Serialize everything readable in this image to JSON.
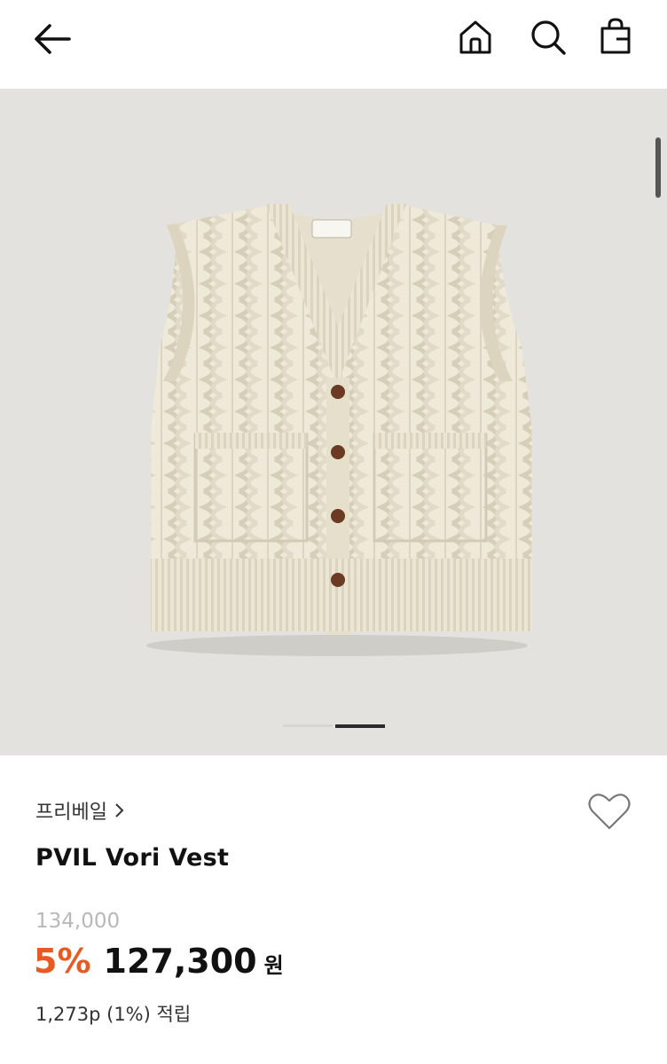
{
  "header": {
    "icons": [
      "arrow-left-icon",
      "home-icon",
      "search-icon",
      "shopping-bag-icon"
    ]
  },
  "gallery": {
    "image": "cream cable-knit vest with brown buttons",
    "slide_count": 2,
    "active_slide": 2
  },
  "product": {
    "brand": "프리베일",
    "title": "PVIL Vori Vest",
    "original_price": "134,000",
    "discount_rate": "5%",
    "sale_price": "127,300",
    "currency": "원",
    "points": "1,273p (1%) 적립"
  },
  "colors": {
    "discount": "#e85a24",
    "gallery_bg": "#e3e2df",
    "vest": "#efe9da"
  }
}
